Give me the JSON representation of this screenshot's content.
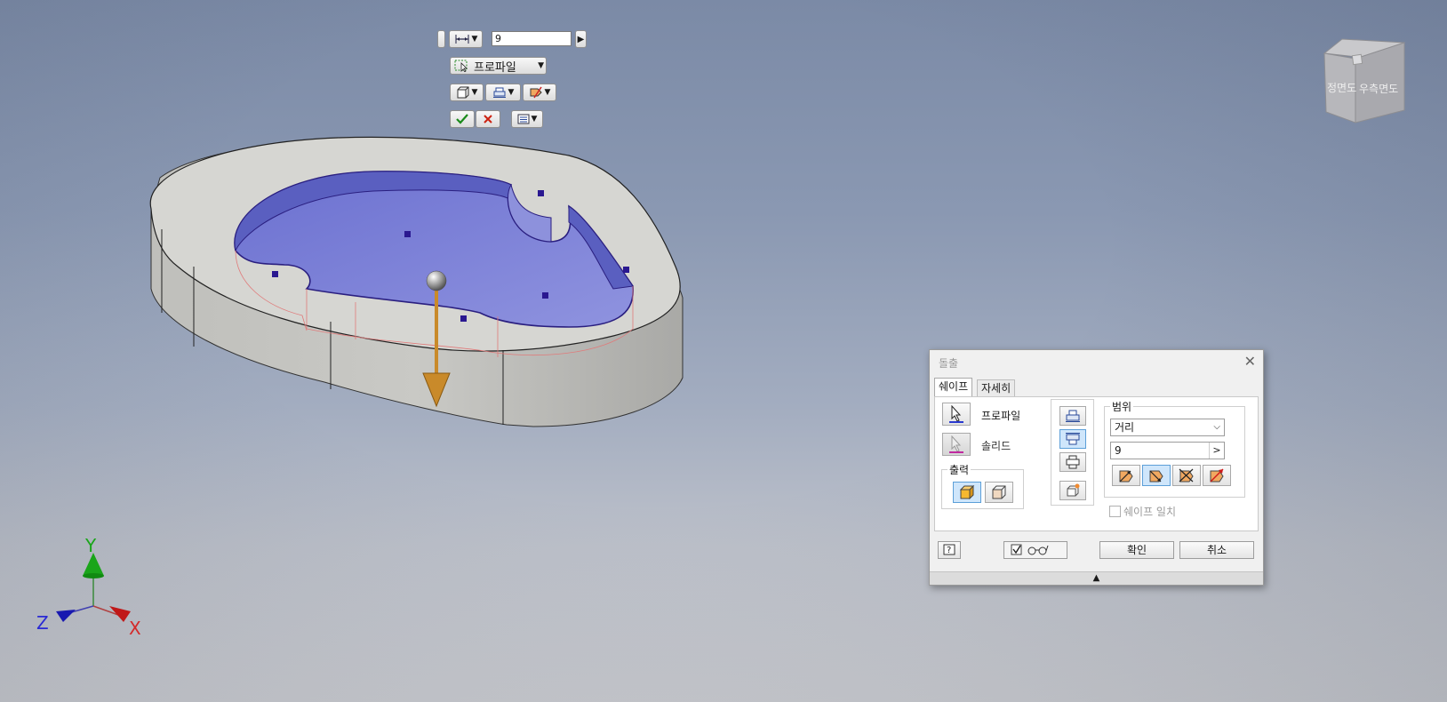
{
  "mini_toolbar": {
    "distance_value": "9",
    "profile_label": "프로파일"
  },
  "viewcube": {
    "front_label": "정면도",
    "right_label": "우측면도"
  },
  "triad": {
    "x_label": "X",
    "y_label": "Y",
    "z_label": "Z"
  },
  "dialog": {
    "title": "돌출",
    "tabs": [
      "쉐이프",
      "자세히"
    ],
    "profile_label": "프로파일",
    "solid_label": "솔리드",
    "output_label": "출력",
    "extent_label": "범위",
    "extent_type": "거리",
    "distance_value": "9",
    "match_shape_label": "쉐이프 일치",
    "ok_label": "확인",
    "cancel_label": "취소",
    "expand_glyph": "▲"
  },
  "colors": {
    "face_blue": "#7b80d6",
    "body_gray": "#c8c8c4",
    "arrow_orange": "#c98a2a",
    "select_blue": "#cfe6fb"
  }
}
